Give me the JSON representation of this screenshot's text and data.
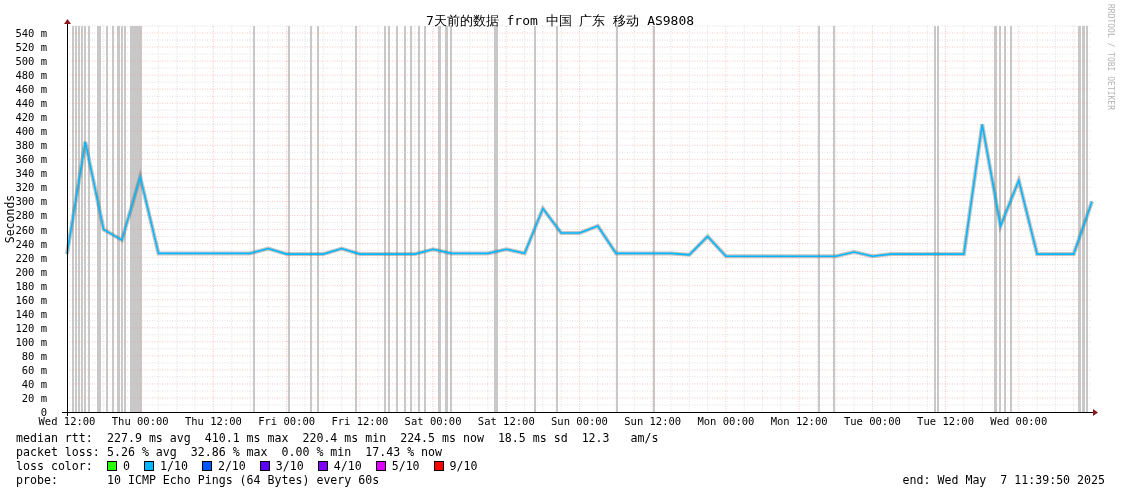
{
  "chart": {
    "credit": "RRDTOOL / TOBI OETIKER",
    "chart_data": {
      "type": "line",
      "title": "7天前的数据 from 中国 广东 移动 AS9808",
      "ylabel": "Seconds",
      "ylim": [
        0,
        550
      ],
      "grid": true,
      "categories": [
        "Wed 12:00",
        null,
        null,
        null,
        "Thu 00:00",
        null,
        null,
        null,
        "Thu 12:00",
        null,
        null,
        null,
        "Fri 00:00",
        null,
        null,
        null,
        "Fri 12:00",
        null,
        null,
        null,
        "Sat 00:00",
        null,
        null,
        null,
        "Sat 12:00",
        null,
        null,
        null,
        "Sun 00:00",
        null,
        null,
        null,
        "Sun 12:00",
        null,
        null,
        null,
        "Mon 00:00",
        null,
        null,
        null,
        "Mon 12:00",
        null,
        null,
        null,
        "Tue 00:00",
        null,
        null,
        null,
        "Tue 12:00",
        null,
        null,
        null,
        "Wed 00:00",
        null,
        null,
        null,
        null
      ],
      "yticks": [
        {
          "value": 0,
          "label": "0"
        },
        {
          "value": 20,
          "label": "20 m"
        },
        {
          "value": 40,
          "label": "40 m"
        },
        {
          "value": 60,
          "label": "60 m"
        },
        {
          "value": 80,
          "label": "80 m"
        },
        {
          "value": 100,
          "label": "100 m"
        },
        {
          "value": 120,
          "label": "120 m"
        },
        {
          "value": 140,
          "label": "140 m"
        },
        {
          "value": 160,
          "label": "160 m"
        },
        {
          "value": 180,
          "label": "180 m"
        },
        {
          "value": 200,
          "label": "200 m"
        },
        {
          "value": 220,
          "label": "220 m"
        },
        {
          "value": 240,
          "label": "240 m"
        },
        {
          "value": 260,
          "label": "260 m"
        },
        {
          "value": 280,
          "label": "280 m"
        },
        {
          "value": 300,
          "label": "300 m"
        },
        {
          "value": 320,
          "label": "320 m"
        },
        {
          "value": 340,
          "label": "340 m"
        },
        {
          "value": 360,
          "label": "360 m"
        },
        {
          "value": 380,
          "label": "380 m"
        },
        {
          "value": 400,
          "label": "400 m"
        },
        {
          "value": 420,
          "label": "420 m"
        },
        {
          "value": 440,
          "label": "440 m"
        },
        {
          "value": 460,
          "label": "460 m"
        },
        {
          "value": 480,
          "label": "480 m"
        },
        {
          "value": 500,
          "label": "500 m"
        },
        {
          "value": 520,
          "label": "520 m"
        },
        {
          "value": 540,
          "label": "540 m"
        }
      ],
      "series": [
        {
          "color": "#00b8ff",
          "values": [
            225,
            385,
            260,
            245,
            335,
            226,
            226,
            226,
            226,
            226,
            226,
            233,
            225,
            225,
            225,
            233,
            225,
            225,
            225,
            225,
            232,
            226,
            226,
            226,
            232,
            226,
            290,
            255,
            255,
            265,
            226,
            226,
            226,
            226,
            224,
            250,
            222,
            222,
            222,
            222,
            222,
            222,
            222,
            228,
            222,
            225,
            225,
            225,
            225,
            225,
            410,
            265,
            330,
            225,
            225,
            225,
            300
          ]
        }
      ]
    }
  },
  "legend": {
    "rows": [
      {
        "label": "median rtt:",
        "text": "227.9 ms avg  410.1 ms max  220.4 ms min  224.5 ms now  18.5 ms sd  12.3   am/s"
      },
      {
        "label": "packet loss:",
        "text": "5.26 % avg  32.86 % max  0.00 % min  17.43 % now"
      }
    ],
    "loss_color_label": "loss color:",
    "loss_colors": [
      {
        "label": "0",
        "color": "#26ff00"
      },
      {
        "label": "1/10",
        "color": "#00b8ff"
      },
      {
        "label": "2/10",
        "color": "#0059ff"
      },
      {
        "label": "3/10",
        "color": "#5e00ff"
      },
      {
        "label": "4/10",
        "color": "#7e00ff"
      },
      {
        "label": "5/10",
        "color": "#dd00ff"
      },
      {
        "label": "9/10",
        "color": "#ff0000"
      }
    ],
    "probe": {
      "label": "probe:",
      "text": "10 ICMP Echo Pings (64 Bytes) every 60s"
    },
    "end": "end: Wed May  7 11:39:50 2025"
  }
}
